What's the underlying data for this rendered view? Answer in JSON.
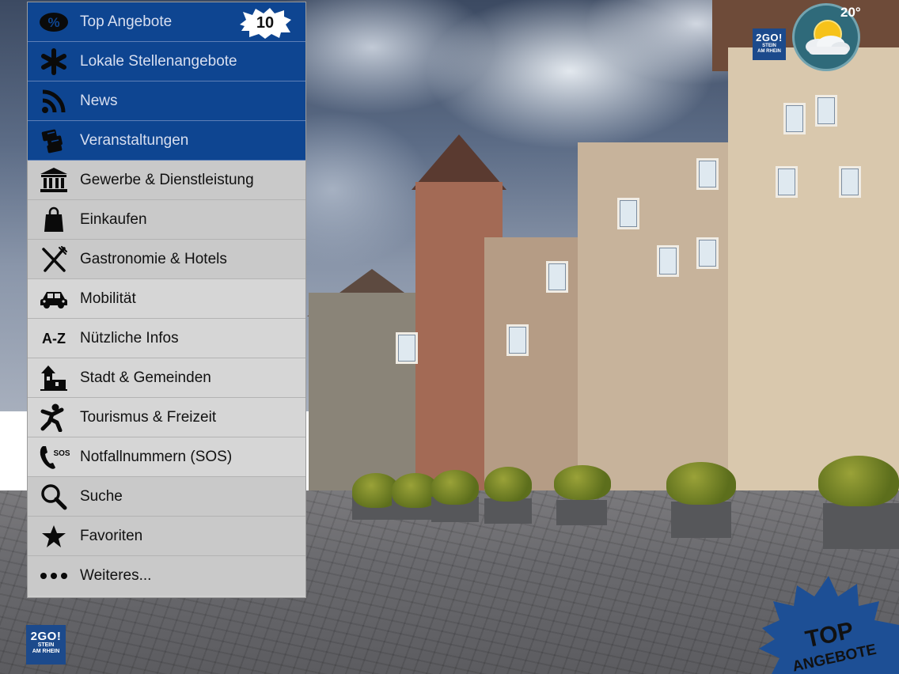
{
  "menu": {
    "items": [
      {
        "label": "Top Angebote",
        "icon": "percent-icon",
        "style": "blue",
        "badge": "10"
      },
      {
        "label": "Lokale Stellenangebote",
        "icon": "asterisk-icon",
        "style": "blue"
      },
      {
        "label": "News",
        "icon": "rss-icon",
        "style": "blue"
      },
      {
        "label": "Veranstaltungen",
        "icon": "tickets-icon",
        "style": "blue"
      },
      {
        "label": "Gewerbe & Dienstleistung",
        "icon": "bank-icon",
        "style": "grey1"
      },
      {
        "label": "Einkaufen",
        "icon": "shopping-bag-icon",
        "style": "grey1"
      },
      {
        "label": "Gastronomie & Hotels",
        "icon": "fork-knife-icon",
        "style": "grey1"
      },
      {
        "label": "Mobilität",
        "icon": "car-icon",
        "style": "grey2"
      },
      {
        "label": "Nützliche Infos",
        "icon": "a-z-icon",
        "icon_text": "A-Z",
        "style": "grey2"
      },
      {
        "label": "Stadt & Gemeinden",
        "icon": "town-icon",
        "style": "grey2"
      },
      {
        "label": "Tourismus & Freizeit",
        "icon": "person-leisure-icon",
        "style": "grey2"
      },
      {
        "label": "Notfallnummern (SOS)",
        "icon": "phone-sos-icon",
        "icon_text": "SOS",
        "style": "grey2"
      },
      {
        "label": "Suche",
        "icon": "search-icon",
        "style": "grey1"
      },
      {
        "label": "Favoriten",
        "icon": "star-icon",
        "style": "grey1"
      },
      {
        "label": "Weiteres...",
        "icon": "more-dots-icon",
        "style": "grey1"
      }
    ]
  },
  "logo": {
    "main": "2GO!",
    "sub1": "STEIN",
    "sub2": "AM RHEIN"
  },
  "weather": {
    "temperature": "20°",
    "icon": "sun-cloud-icon"
  },
  "promo": {
    "line1": "TOP",
    "line2": "ANGEBOTE"
  },
  "colors": {
    "menu_blue": "#0e4591",
    "menu_grey": "#cfcfcf",
    "logo_blue": "#1c4a8c"
  }
}
